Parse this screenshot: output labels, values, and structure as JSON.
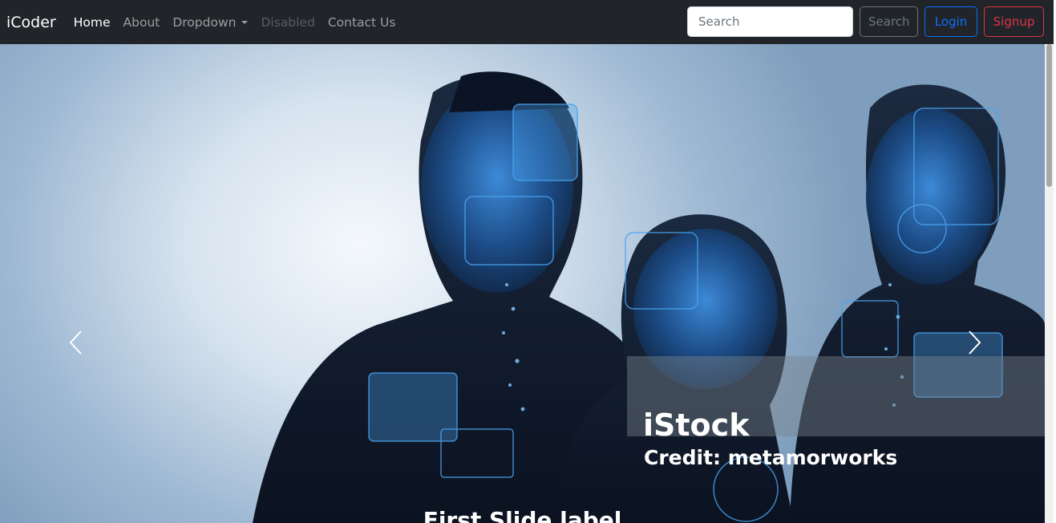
{
  "navbar": {
    "brand": "iCoder",
    "links": [
      {
        "label": "Home",
        "state": "active"
      },
      {
        "label": "About",
        "state": "normal"
      },
      {
        "label": "Dropdown",
        "state": "dropdown"
      },
      {
        "label": "Disabled",
        "state": "disabled"
      },
      {
        "label": "Contact Us",
        "state": "normal"
      }
    ],
    "search": {
      "placeholder": "Search",
      "value": ""
    },
    "search_button": "Search",
    "login_button": "Login",
    "signup_button": "Signup"
  },
  "carousel": {
    "watermark_brand": "iStock",
    "watermark_credit": "Credit: metamorworks",
    "caption_title": "First Slide label"
  },
  "colors": {
    "navbar_bg": "#212529",
    "login": "#0d6efd",
    "signup": "#dc3545",
    "search_button": "#6c757d",
    "hologram": "#2f7fd0"
  },
  "icons": [
    "carousel-prev-icon",
    "carousel-next-icon",
    "dropdown-caret-icon"
  ]
}
